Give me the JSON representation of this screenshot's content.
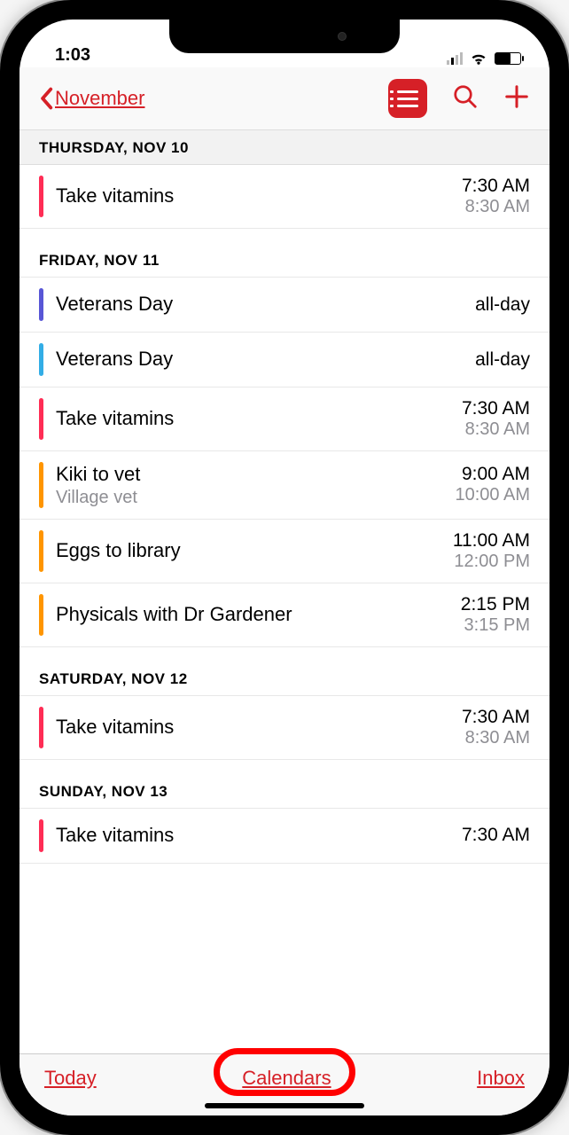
{
  "status": {
    "time": "1:03"
  },
  "nav": {
    "back_label": "November"
  },
  "colors": {
    "pink": "#ff2d55",
    "purple": "#5856d6",
    "cyan": "#32ade6",
    "orange": "#ff9500"
  },
  "sections": [
    {
      "header": "THURSDAY, NOV 10",
      "header_style": "gray",
      "events": [
        {
          "color": "pink",
          "title": "Take vitamins",
          "subtitle": "",
          "time_start": "7:30 AM",
          "time_end": "8:30 AM"
        }
      ]
    },
    {
      "header": "FRIDAY, NOV 11",
      "header_style": "plain",
      "events": [
        {
          "color": "purple",
          "title": "Veterans Day",
          "subtitle": "",
          "time_start": "all-day",
          "time_end": ""
        },
        {
          "color": "cyan",
          "title": "Veterans Day",
          "subtitle": "",
          "time_start": "all-day",
          "time_end": ""
        },
        {
          "color": "pink",
          "title": "Take vitamins",
          "subtitle": "",
          "time_start": "7:30 AM",
          "time_end": "8:30 AM"
        },
        {
          "color": "orange",
          "title": "Kiki to vet",
          "subtitle": "Village vet",
          "time_start": "9:00 AM",
          "time_end": "10:00 AM"
        },
        {
          "color": "orange",
          "title": "Eggs to library",
          "subtitle": "",
          "time_start": "11:00 AM",
          "time_end": "12:00 PM"
        },
        {
          "color": "orange",
          "title": "Physicals with Dr Gardener",
          "subtitle": "",
          "time_start": "2:15 PM",
          "time_end": "3:15 PM"
        }
      ]
    },
    {
      "header": "SATURDAY, NOV 12",
      "header_style": "plain",
      "events": [
        {
          "color": "pink",
          "title": "Take vitamins",
          "subtitle": "",
          "time_start": "7:30 AM",
          "time_end": "8:30 AM"
        }
      ]
    },
    {
      "header": "SUNDAY, NOV 13",
      "header_style": "plain",
      "events": [
        {
          "color": "pink",
          "title": "Take vitamins",
          "subtitle": "",
          "time_start": "7:30 AM",
          "time_end": ""
        }
      ]
    }
  ],
  "toolbar": {
    "today_label": "Today",
    "calendars_label": "Calendars",
    "inbox_label": "Inbox"
  }
}
